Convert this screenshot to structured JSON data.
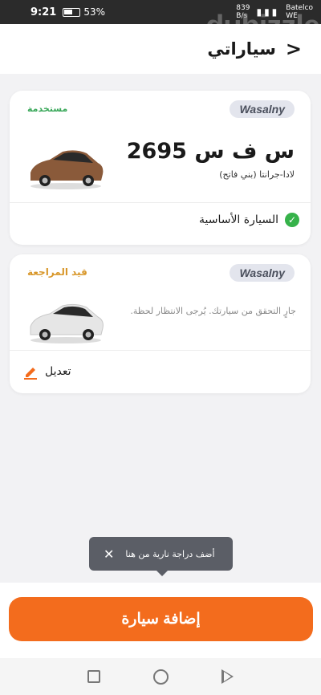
{
  "status_bar": {
    "time": "9:21",
    "battery": "53%",
    "data_speed": "839",
    "data_unit": "B/s",
    "carrier": "Batelco",
    "carrier_sub": "WE"
  },
  "watermark": "dubizzle",
  "header": {
    "title": "سياراتي"
  },
  "cars": [
    {
      "brand": "Wasalny",
      "status": "مستخدمة",
      "plate": "س ف س 2695",
      "model": "لادا-جرانتا (بني فاتح)",
      "primary_label": "السيارة الأساسية",
      "car_color": "#8a5a3a"
    },
    {
      "brand": "Wasalny",
      "status": "قيد المراجعة",
      "pending_message": ".جارٍ التحقق من سيارتك. يُرجى الانتظار لحظة",
      "edit_label": "تعديل",
      "car_color": "#e6e6e6"
    }
  ],
  "tooltip": {
    "text": "أضف دراجة نارية من هنا"
  },
  "add_button": {
    "label": "إضافة سيارة"
  },
  "colors": {
    "accent": "#f36c1d",
    "success": "#36b24a",
    "review": "#d8972a"
  }
}
